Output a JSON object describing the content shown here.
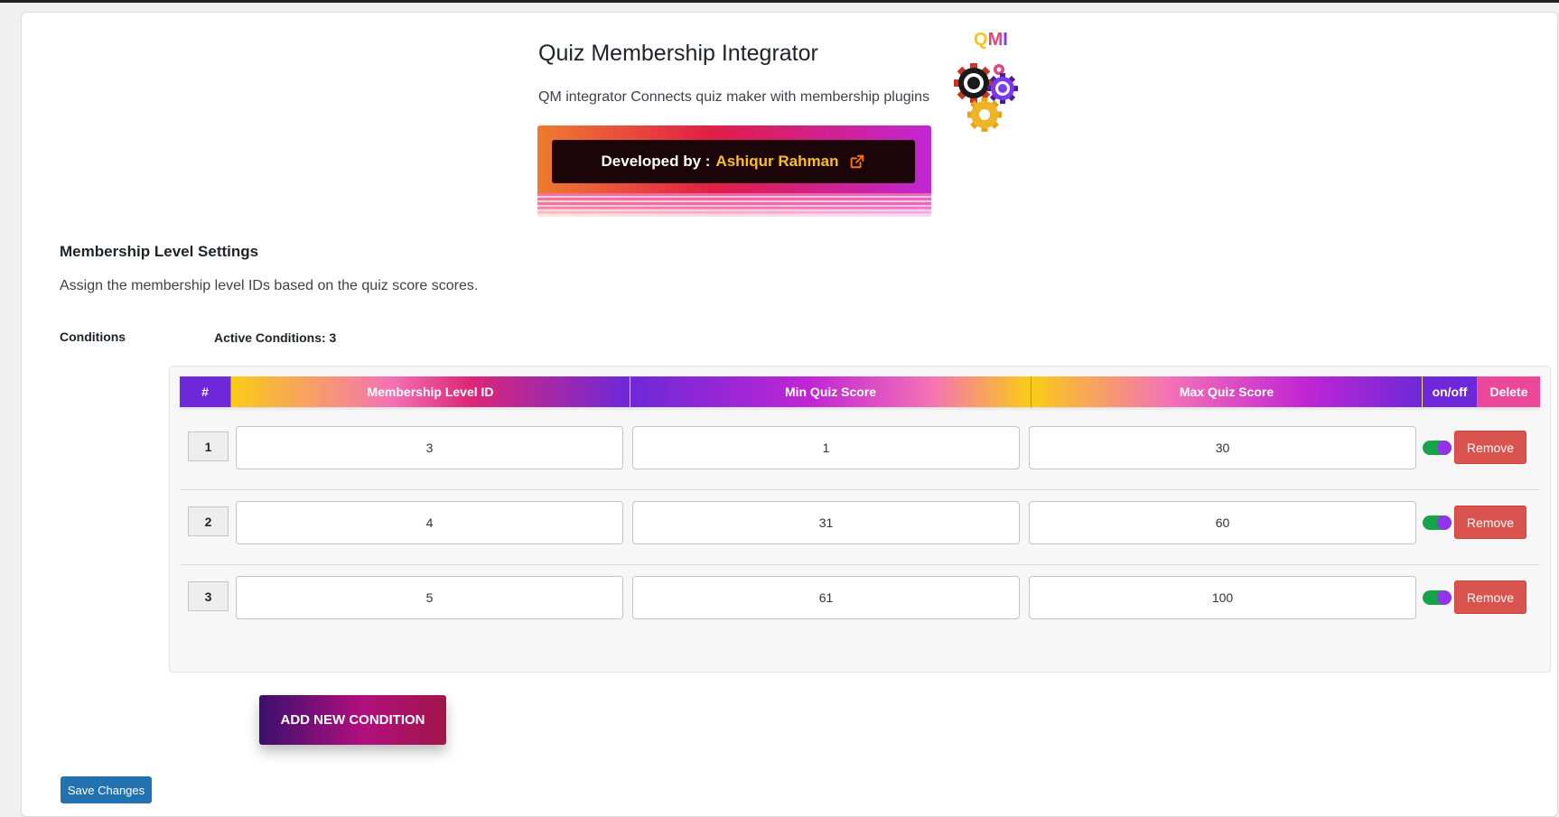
{
  "header": {
    "title": "Quiz Membership Integrator",
    "description": "QM integrator Connects quiz maker with membership plugins",
    "logo_text": [
      "Q",
      "M",
      "I"
    ],
    "logo_colors": [
      "#f5c518",
      "#e0457b",
      "#7c3aed"
    ],
    "developer_prefix": "Developed by :",
    "developer_name": "Ashiqur Rahman"
  },
  "section": {
    "title": "Membership Level Settings",
    "description": "Assign the membership level IDs based on the quiz score scores.",
    "conditions_label": "Conditions",
    "active_conditions": "Active Conditions: 3"
  },
  "table": {
    "headers": {
      "num": "#",
      "level": "Membership Level ID",
      "min": "Min Quiz Score",
      "max": "Max Quiz Score",
      "onoff": "on/off",
      "delete": "Delete"
    },
    "rows": [
      {
        "num": "1",
        "level": "3",
        "min": "1",
        "max": "30",
        "enabled": true,
        "remove_label": "Remove"
      },
      {
        "num": "2",
        "level": "4",
        "min": "31",
        "max": "60",
        "enabled": true,
        "remove_label": "Remove"
      },
      {
        "num": "3",
        "level": "5",
        "min": "61",
        "max": "100",
        "enabled": true,
        "remove_label": "Remove"
      }
    ]
  },
  "actions": {
    "add_condition": "ADD NEW CONDITION",
    "save_changes": "Save Changes"
  },
  "colors": {
    "accent_purple": "#6d28d9",
    "accent_pink": "#ec4899",
    "remove_red": "#d9534f",
    "save_blue": "#2271b1",
    "toggle_on": "#16a34a"
  },
  "icons": [
    "gears-logo-icon",
    "external-link-icon"
  ]
}
